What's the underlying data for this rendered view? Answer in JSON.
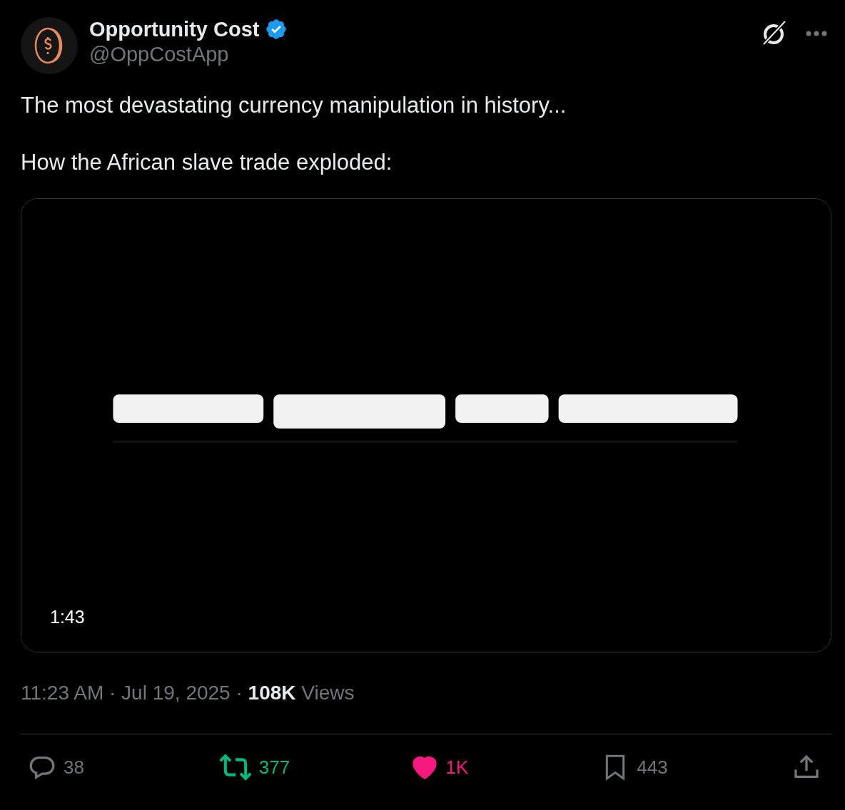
{
  "author": {
    "name": "Opportunity Cost",
    "verified": true,
    "handle": "@OppCostApp"
  },
  "text": [
    "The most devastating currency manipulation in history...",
    "How the African slave trade exploded:"
  ],
  "media": {
    "kind": "picture",
    "duration": "1:43"
  },
  "meta": {
    "line": "11:23 AM · Jul 19, 2025 · **108K** Views"
  },
  "actions": [
    {
      "kind": "reply",
      "count": "38",
      "on": false
    },
    {
      "kind": "repost",
      "count": "377",
      "on": true
    },
    {
      "kind": "like",
      "count": "1K",
      "on": true
    },
    {
      "kind": "bookmark",
      "count": "443",
      "on": false
    },
    {
      "kind": "share"
    }
  ]
}
